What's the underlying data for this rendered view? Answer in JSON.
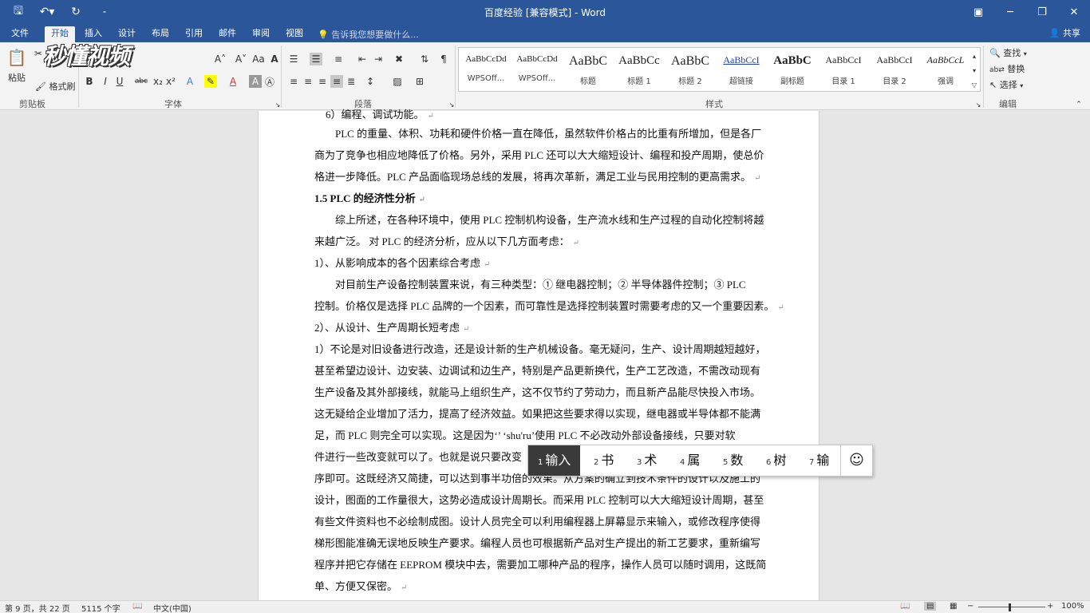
{
  "window": {
    "title": "百度经验 [兼容模式] - Word",
    "qat": [
      "save-icon",
      "undo-icon",
      "redo-icon",
      "customize-icon"
    ],
    "controls": [
      "ribbon-display-icon",
      "minimize-icon",
      "restore-icon",
      "close-icon"
    ]
  },
  "tabs": [
    "文件",
    "开始",
    "插入",
    "设计",
    "布局",
    "引用",
    "邮件",
    "审阅",
    "视图"
  ],
  "active_tab": "开始",
  "tell_me": "告诉我您想要做什么...",
  "share": "共享",
  "ribbon": {
    "clipboard": {
      "paste": "粘贴",
      "format_painter": "格式刷",
      "group": "剪贴板"
    },
    "font": {
      "group": "字体",
      "buttons": [
        "B",
        "I",
        "U",
        "abc",
        "x₂",
        "x²",
        "A",
        "A"
      ]
    },
    "paragraph": {
      "group": "段落"
    },
    "styles": {
      "group": "样式",
      "items": [
        {
          "sample": "AaBbCcDd",
          "name": "WPSOff..."
        },
        {
          "sample": "AaBbCcDd",
          "name": "WPSOff..."
        },
        {
          "sample": "AaBbC",
          "name": "标题"
        },
        {
          "sample": "AaBbCc",
          "name": "标题 1"
        },
        {
          "sample": "AaBbC",
          "name": "标题 2"
        },
        {
          "sample": "AaBbCcI",
          "name": "超链接"
        },
        {
          "sample": "AaBbC",
          "name": "副标题"
        },
        {
          "sample": "AaBbCcI",
          "name": "目录 1"
        },
        {
          "sample": "AaBbCcI",
          "name": "目录 2"
        },
        {
          "sample": "AaBbCcL",
          "name": "强调"
        }
      ]
    },
    "editing": {
      "group": "编辑",
      "find": "查找",
      "replace": "替换",
      "select": "选择"
    }
  },
  "watermark_logo": "秒懂视频",
  "document": {
    "lines": [
      {
        "text": "6）编程、调试功能。",
        "style": "normal"
      },
      {
        "text": "PLC 的重量、体积、功耗和硬件价格一直在降低，虽然软件价格占的比重有所增加，但是各厂",
        "style": "indent"
      },
      {
        "text": "商为了竞争也相应地降低了价格。另外，采用 PLC 还可以大大缩短设计、编程和投产周期，使总价",
        "style": "normal"
      },
      {
        "text": "格进一步降低。PLC 产品面临现场总线的发展，将再次革新，满足工业与民用控制的更高需求。",
        "style": "normal"
      },
      {
        "text": "1.5  PLC 的经济性分析",
        "style": "heading"
      },
      {
        "text": "综上所述，在各种环境中，使用 PLC 控制机构设备，生产流水线和生产过程的自动化控制将越",
        "style": "indent"
      },
      {
        "text": "来越广泛。   对 PLC 的经济分析，应从以下几方面考虑：",
        "style": "normal"
      },
      {
        "text": "1）、从影响成本的各个因素综合考虑",
        "style": "normal"
      },
      {
        "text": "对目前生产设备控制装置来说，有三种类型：① 继电器控制；② 半导体器件控制；③ PLC",
        "style": "indent"
      },
      {
        "text": "控制。价格仅是选择 PLC 品牌的一个因素，而可靠性是选择控制装置时需要考虑的又一个重要因素。",
        "style": "normal"
      },
      {
        "text": "2）、从设计、生产周期长短考虑",
        "style": "normal"
      },
      {
        "text": "1）不论是对旧设备进行改造，还是设计新的生产机械设备。毫无疑问，生产、设计周期越短越好，",
        "style": "normal"
      },
      {
        "text": "甚至希望边设计、边安装、边调试和边生产，特别是产品更新换代，生产工艺改造，不需改动现有",
        "style": "normal"
      },
      {
        "text": "生产设备及其外部接线，就能马上组织生产，这不仅节约了劳动力，而且新产品能尽快投入市场。",
        "style": "normal"
      },
      {
        "text": "这无疑给企业增加了活力，提高了经济效益。如果把这些要求得以实现，继电器或半导体都不能满",
        "style": "normal"
      },
      {
        "text": "足，而 PLC 则完全可以实现。这是因为‘’  ‘shu'ru’使用 PLC 不必改动外部设备接线，只要对软",
        "style": "normal"
      },
      {
        "text": "件进行一些改变就可以了。也就是说只要改变",
        "style": "normal"
      },
      {
        "text": "序即可。这既经济又简捷，可以达到事半功倍的效果。从方案的确立到技术条件的设计以及施工的",
        "style": "normal"
      },
      {
        "text": "设计，图面的工作量很大，这势必造成设计周期长。而采用 PLC 控制可以大大缩短设计周期，甚至",
        "style": "normal"
      },
      {
        "text": "有些文件资料也不必绘制成图。设计人员完全可以利用编程器上屏幕显示来输入，或修改程序使得",
        "style": "normal"
      },
      {
        "text": "梯形图能准确无误地反映生产要求。编程人员也可根据新产品对生产提出的新工艺要求，重新编写",
        "style": "normal"
      },
      {
        "text": "程序并把它存储在 EEPROM 模块中去，需要加工哪种产品的程序，操作人员可以随时调用，这既简",
        "style": "normal"
      },
      {
        "text": "单、方便又保密。",
        "style": "normal"
      }
    ]
  },
  "ime": {
    "candidates": [
      {
        "n": "1",
        "word": "输入"
      },
      {
        "n": "2",
        "word": "书"
      },
      {
        "n": "3",
        "word": "术"
      },
      {
        "n": "4",
        "word": "属"
      },
      {
        "n": "5",
        "word": "数"
      },
      {
        "n": "6",
        "word": "树"
      },
      {
        "n": "7",
        "word": "输"
      }
    ],
    "emoji": "☺"
  },
  "status": {
    "page": "第 9 页，共 22 页",
    "words": "5115 个字",
    "language": "中文(中国)",
    "zoom": "100%"
  }
}
